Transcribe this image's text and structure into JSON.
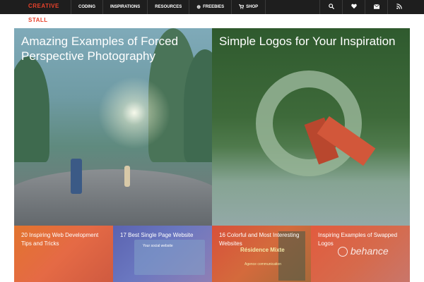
{
  "header": {
    "logo_top": "CREATIVE",
    "logo_bottom": "STALL",
    "nav": [
      {
        "label": "CODING",
        "icon": ""
      },
      {
        "label": "INSPIRATIONS",
        "icon": ""
      },
      {
        "label": "RESOURCES",
        "icon": ""
      },
      {
        "label": "FREEBIES",
        "icon": "⊕"
      },
      {
        "label": "SHOP",
        "icon": "🛒"
      }
    ],
    "icons": [
      "search-icon",
      "heart-icon",
      "mail-icon",
      "rss-icon"
    ]
  },
  "hero": [
    {
      "title": "Amazing Examples of Forced Perspective Photography"
    },
    {
      "title": "Simple Logos for Your Inspiration"
    }
  ],
  "tiles": [
    {
      "title": "20 Inspiring Web Development Tips and Tricks"
    },
    {
      "title": "17 Best Single Page Website",
      "image_text": "Your social website"
    },
    {
      "title": "16 Colorful and Most Interesting Websites",
      "image_text": "Résidence Mixte",
      "image_subtext": "Agence communication"
    },
    {
      "title": "Inspiring Examples of Swapped Logos",
      "image_text": "behance"
    }
  ]
}
